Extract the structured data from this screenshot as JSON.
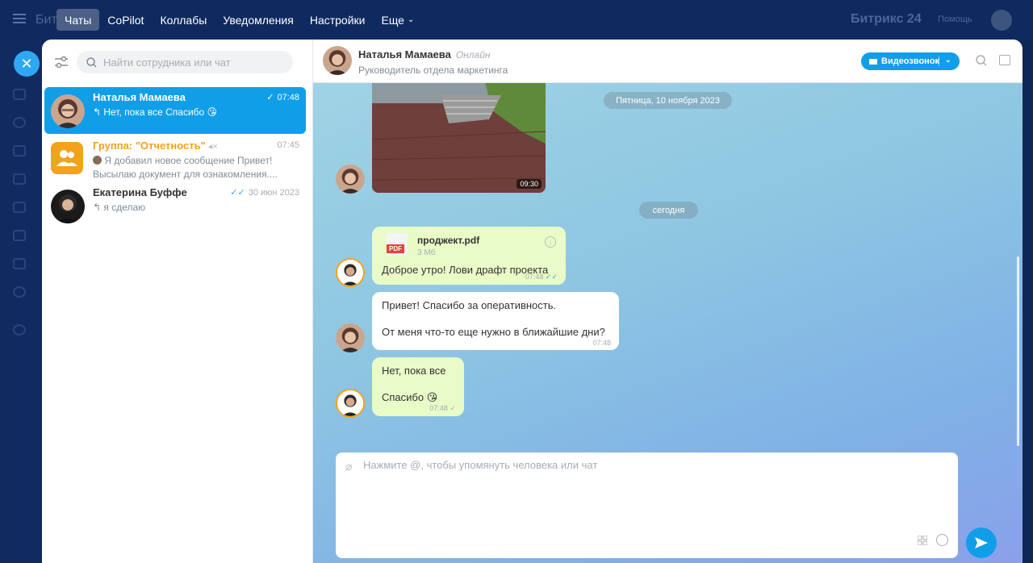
{
  "topbar": {
    "nav": [
      "Чаты",
      "CoPilot",
      "Коллабы",
      "Уведомления",
      "Настройки",
      "Еще"
    ],
    "brand_left": "Бит",
    "brand_right": "Битрикс 24",
    "help": "Помощь"
  },
  "search": {
    "placeholder": "Найти сотрудника или чат"
  },
  "chats": [
    {
      "name": "Наталья Мамаева",
      "time": "07:48",
      "preview": "Нет, пока все Спасибо 😘",
      "read": "✓"
    },
    {
      "name": "Группа: \"Отчетность\"",
      "time": "07:45",
      "preview1": "Я добавил новое сообщение Привет!",
      "preview2": "Высылаю документ для ознакомления...."
    },
    {
      "name": "Екатерина Буффе",
      "time": "30 июн 2023",
      "preview": "я сделаю",
      "read": "✓✓"
    }
  ],
  "conversation": {
    "name": "Наталья Мамаева",
    "status": "Онлайн",
    "role": "Руководитель отдела маркетинга",
    "video_label": "Видеозвонок",
    "photo_duration": "09:30",
    "date_1": "Пятница, 10 ноября 2023",
    "date_2": "сегодня",
    "messages": [
      {
        "file_name": "проджект.pdf",
        "file_size": "3 Мб",
        "file_type": "PDF",
        "text": "Доброе утро! Лови драфт проекта",
        "time": "07:48"
      },
      {
        "line1": "Привет! Спасибо за оперативность.",
        "line2": "От меня что-то еще нужно в ближайшие дни?",
        "time": "07:48"
      },
      {
        "line1": "Нет, пока все",
        "line2": "Спасибо 😘",
        "time": "07:48"
      }
    ]
  },
  "composer": {
    "placeholder": "Нажмите @, чтобы упомянуть человека или чат"
  },
  "colors": {
    "accent": "#119ee8",
    "group": "#f2a21b",
    "mine_bubble": "#e9fbc7"
  }
}
